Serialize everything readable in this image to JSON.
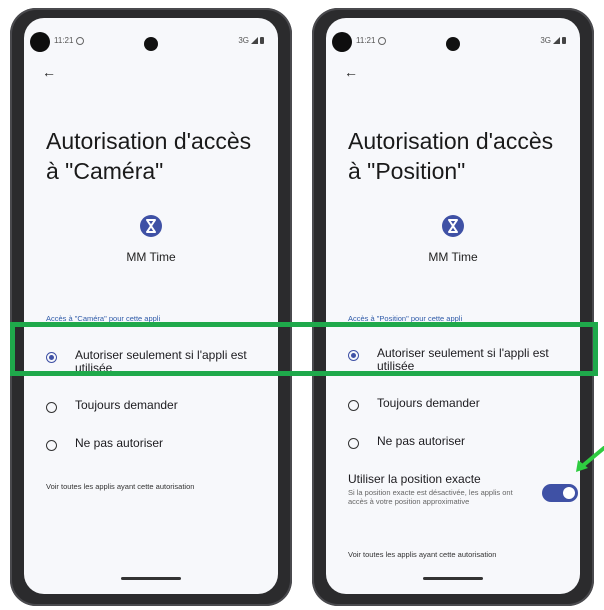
{
  "colors": {
    "accent": "#3f51a5",
    "highlight": "#1fa94b",
    "arrow": "#2ecc40"
  },
  "phones": [
    {
      "status": {
        "time": "11:21",
        "network": "3G"
      },
      "title": "Autorisation d'accès à \"Caméra\"",
      "app_name": "MM Time",
      "app_icon": "hourglass-app-icon",
      "section_label": "Accès à \"Caméra\" pour cette appli",
      "options": [
        {
          "label": "Autoriser seulement si l'appli est utilisée",
          "selected": true
        },
        {
          "label": "Toujours demander",
          "selected": false
        },
        {
          "label": "Ne pas autoriser",
          "selected": false
        }
      ],
      "footer_link": "Voir toutes les applis ayant cette autorisation"
    },
    {
      "status": {
        "time": "11:21",
        "network": "3G"
      },
      "title": "Autorisation d'accès à \"Position\"",
      "app_name": "MM Time",
      "app_icon": "hourglass-app-icon",
      "section_label": "Accès à \"Position\" pour cette appli",
      "options": [
        {
          "label": "Autoriser seulement si l'appli est utilisée",
          "selected": true
        },
        {
          "label": "Toujours demander",
          "selected": false
        },
        {
          "label": "Ne pas autoriser",
          "selected": false
        }
      ],
      "exact_location": {
        "title": "Utiliser la position exacte",
        "description": "Si la position exacte est désactivée, les applis ont accès à votre position approximative",
        "enabled": true
      },
      "footer_link": "Voir toutes les applis ayant cette autorisation"
    }
  ]
}
